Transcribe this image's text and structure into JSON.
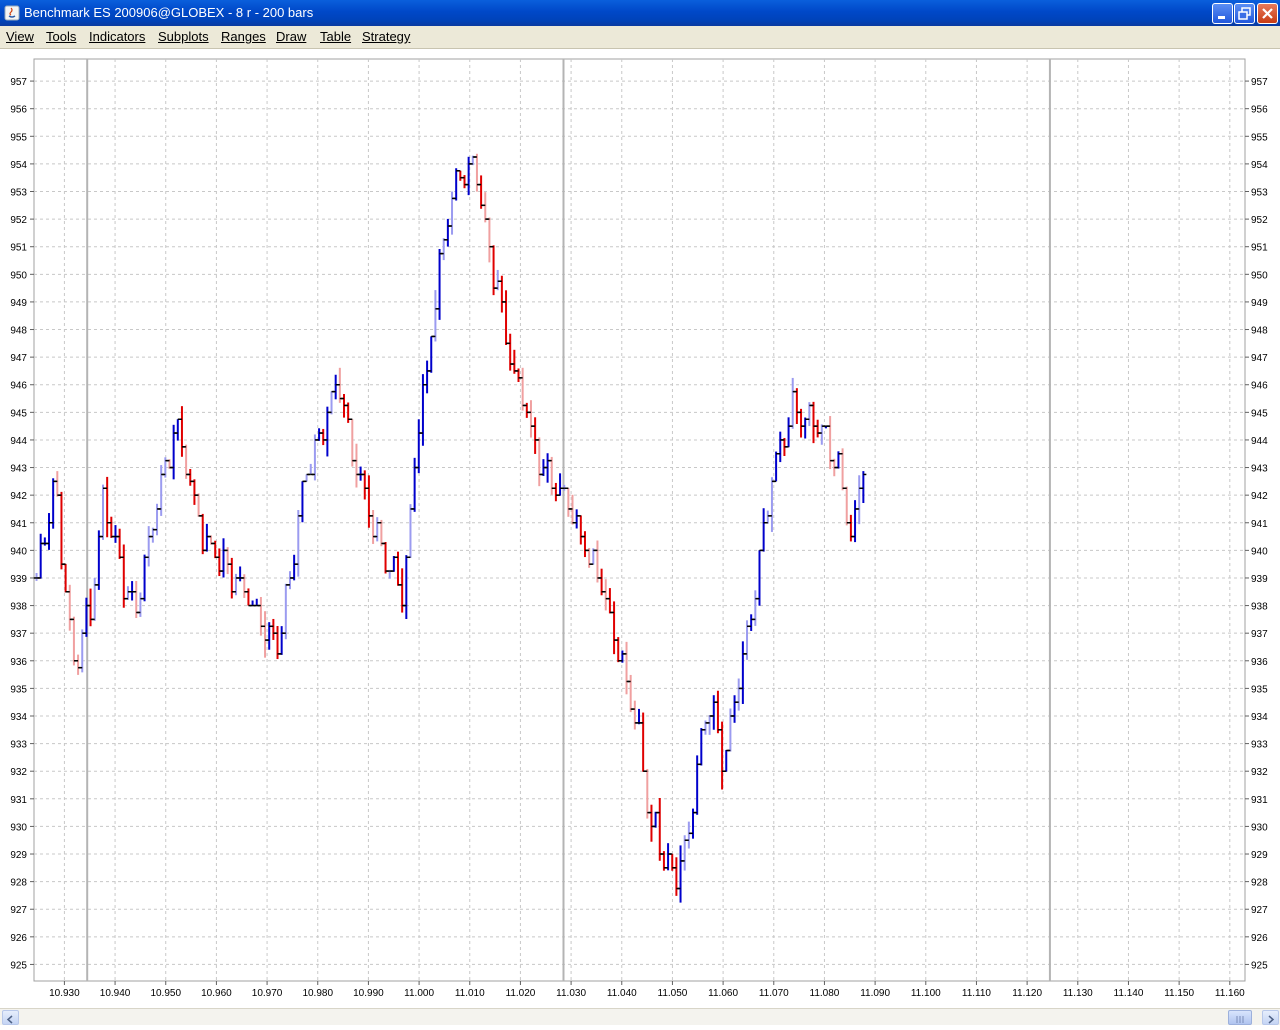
{
  "window": {
    "title": "Benchmark ES 200906@GLOBEX - 8 r - 200 bars",
    "controls": [
      "minimize-icon",
      "maximize-icon",
      "close-icon"
    ]
  },
  "menu": {
    "items": [
      "View",
      "Tools",
      "Indicators",
      "Subplots",
      "Ranges",
      "Draw",
      "Table",
      "Strategy"
    ]
  },
  "colors": {
    "up_dark": "#0000cc",
    "up_light": "#9b9bf0",
    "down_dark": "#e00000",
    "down_light": "#f0a0a0",
    "tick": "#000000",
    "grid": "#c8c8c8",
    "session_line": "#b4b4b4"
  },
  "chart_data": {
    "type": "bar",
    "subtype": "range-ohlc",
    "ylim": [
      924.4,
      957.8
    ],
    "xlim": [
      10.924,
      11.163
    ],
    "y_ticks": [
      925,
      926,
      927,
      928,
      929,
      930,
      931,
      932,
      933,
      934,
      935,
      936,
      937,
      938,
      939,
      940,
      941,
      942,
      943,
      944,
      945,
      946,
      947,
      948,
      949,
      950,
      951,
      952,
      953,
      954,
      955,
      956,
      957
    ],
    "x_ticks": [
      "10.930",
      "10.940",
      "10.950",
      "10.960",
      "10.970",
      "10.980",
      "10.990",
      "11.000",
      "11.010",
      "11.020",
      "11.030",
      "11.040",
      "11.050",
      "11.060",
      "11.070",
      "11.080",
      "11.090",
      "11.100",
      "11.110",
      "11.120",
      "11.130",
      "11.140",
      "11.150",
      "11.160"
    ],
    "session_lines": [
      10.9345,
      11.0285,
      11.1245
    ],
    "grid": true,
    "bar_count": 200,
    "x_start": 10.9245,
    "x_step": 0.00082,
    "waypoints": [
      [
        0,
        939
      ],
      [
        6,
        942.7
      ],
      [
        12,
        935.8
      ],
      [
        18,
        938
      ],
      [
        22,
        942
      ],
      [
        32,
        937.5
      ],
      [
        40,
        942
      ],
      [
        46,
        944.6
      ],
      [
        55,
        940.4
      ],
      [
        70,
        938.3
      ],
      [
        80,
        936.5
      ],
      [
        88,
        942.5
      ],
      [
        99,
        946.2
      ],
      [
        104,
        943.2
      ],
      [
        115,
        939.7
      ],
      [
        121,
        938.3
      ],
      [
        124,
        943
      ],
      [
        136,
        952.8
      ],
      [
        144,
        954.3
      ],
      [
        148,
        951.2
      ],
      [
        158,
        946.2
      ],
      [
        165,
        943.5
      ],
      [
        175,
        941.7
      ],
      [
        186,
        938.8
      ],
      [
        198,
        933.3
      ],
      [
        202,
        930.2
      ],
      [
        210,
        928.2
      ],
      [
        214,
        929.4
      ],
      [
        221,
        934.8
      ],
      [
        226,
        932.2
      ],
      [
        235,
        937.5
      ],
      [
        242,
        942.5
      ],
      [
        248,
        945
      ],
      [
        257,
        944.5
      ],
      [
        264,
        943
      ],
      [
        268,
        940.2
      ],
      [
        272,
        943.4
      ]
    ]
  }
}
